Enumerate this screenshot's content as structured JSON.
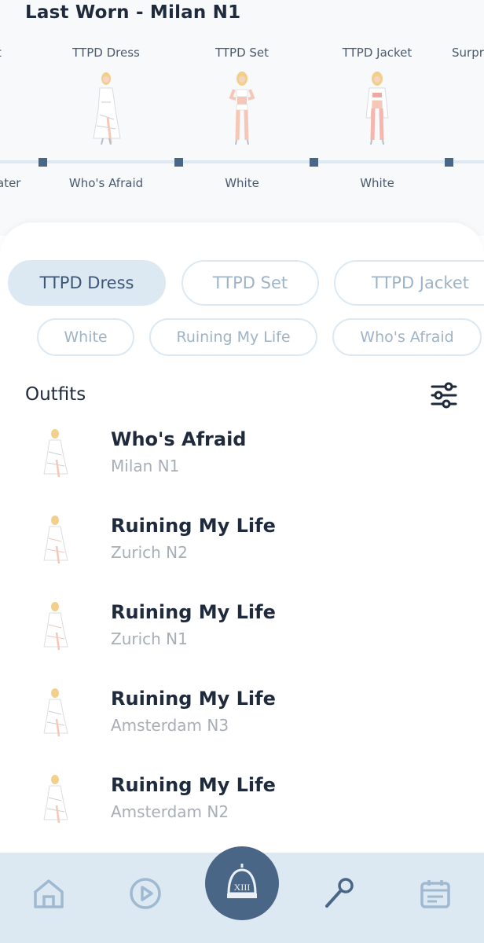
{
  "header": {
    "title": "Last Worn - Milan N1"
  },
  "timeline": {
    "partial_left_top": "t",
    "partial_left_bottom": "ater",
    "partial_right_top": "Surpr",
    "items": [
      {
        "label": "TTPD Dress",
        "song": "Who's Afraid"
      },
      {
        "label": "TTPD Set",
        "song": "White"
      },
      {
        "label": "TTPD Jacket",
        "song": "White"
      }
    ]
  },
  "filters": {
    "outfit_chips": [
      "TTPD Dress",
      "TTPD Set",
      "TTPD Jacket"
    ],
    "song_chips": [
      "White",
      "Ruining My Life",
      "Who's Afraid"
    ],
    "active_outfit": "TTPD Dress"
  },
  "outfits": {
    "title": "Outfits",
    "items": [
      {
        "title": "Who's Afraid",
        "subtitle": "Milan N1"
      },
      {
        "title": "Ruining My Life",
        "subtitle": "Zurich N2"
      },
      {
        "title": "Ruining My Life",
        "subtitle": "Zurich N1"
      },
      {
        "title": "Ruining My Life",
        "subtitle": "Amsterdam N3"
      },
      {
        "title": "Ruining My Life",
        "subtitle": "Amsterdam N2"
      }
    ]
  },
  "nav": {
    "items": [
      "home-icon",
      "play-icon",
      "bell-xiii-icon",
      "microphone-icon",
      "calendar-icon"
    ]
  },
  "colors": {
    "accent": "#4a6687",
    "chip_active_bg": "#dde9f2",
    "nav_bg": "#dde9f2",
    "timeline_line": "#dce9f3"
  }
}
